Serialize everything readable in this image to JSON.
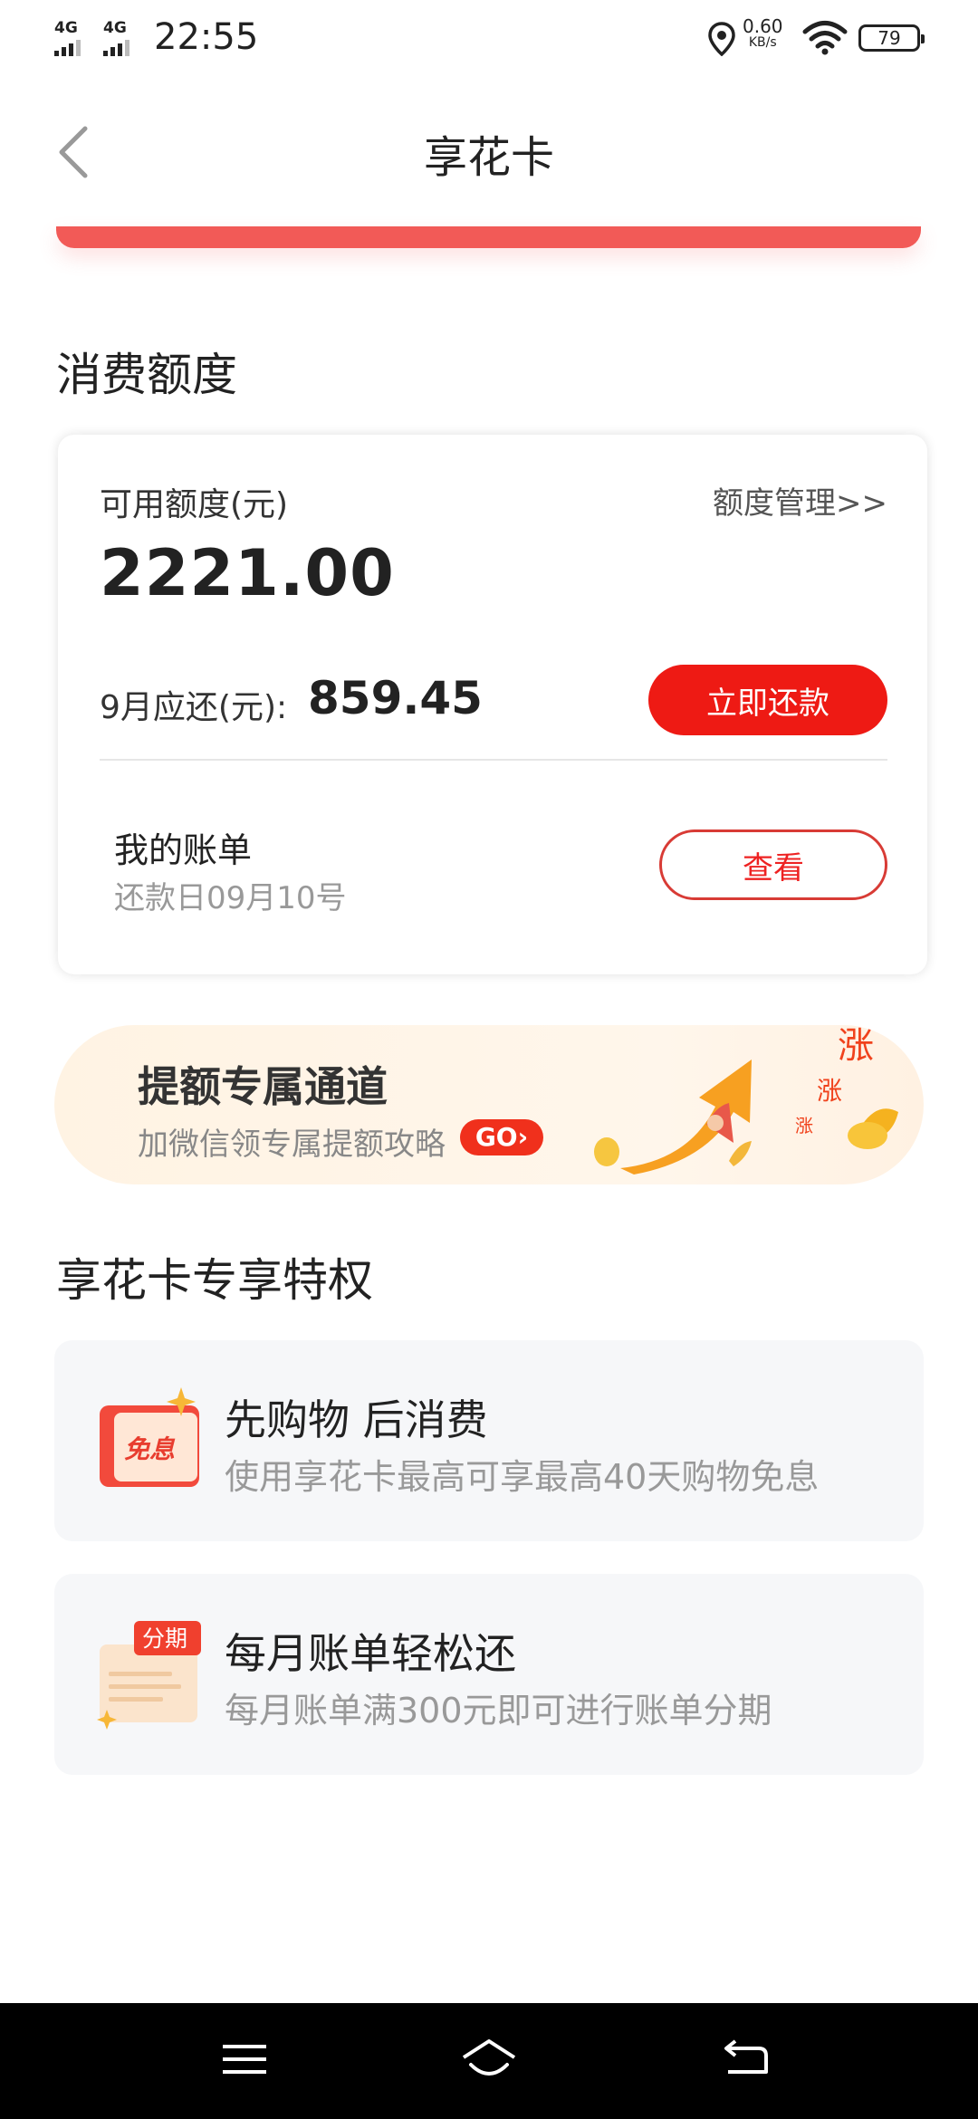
{
  "status_bar": {
    "network1": "4G",
    "network2": "4G",
    "time": "22:55",
    "speed_value": "0.60",
    "speed_unit": "KB/s",
    "battery": "79"
  },
  "header": {
    "title": "享花卡"
  },
  "credit_section": {
    "heading": "消费额度",
    "available_label": "可用额度(元)",
    "manage_link": "额度管理>>",
    "available_amount": "2221.00",
    "due_label": "9月应还(元):",
    "due_amount": "859.45",
    "pay_button": "立即还款",
    "bill_title": "我的账单",
    "bill_date": "还款日09月10号",
    "view_button": "查看"
  },
  "banner": {
    "title": "提额专属通道",
    "subtitle": "加微信领专属提额攻略",
    "go_label": "GO",
    "art_text": "涨"
  },
  "privileges": {
    "heading": "享花卡专享特权",
    "items": [
      {
        "icon_text": "免息",
        "title": "先购物 后消费",
        "subtitle": "使用享花卡最高可享最高40天购物免息"
      },
      {
        "icon_text": "分期",
        "title": "每月账单轻松还",
        "subtitle": "每月账单满300元即可进行账单分期"
      }
    ]
  },
  "colors": {
    "accent_red": "#ee1a14",
    "banner_bg": "#fff3e3",
    "card_bg": "#f6f7f9"
  }
}
